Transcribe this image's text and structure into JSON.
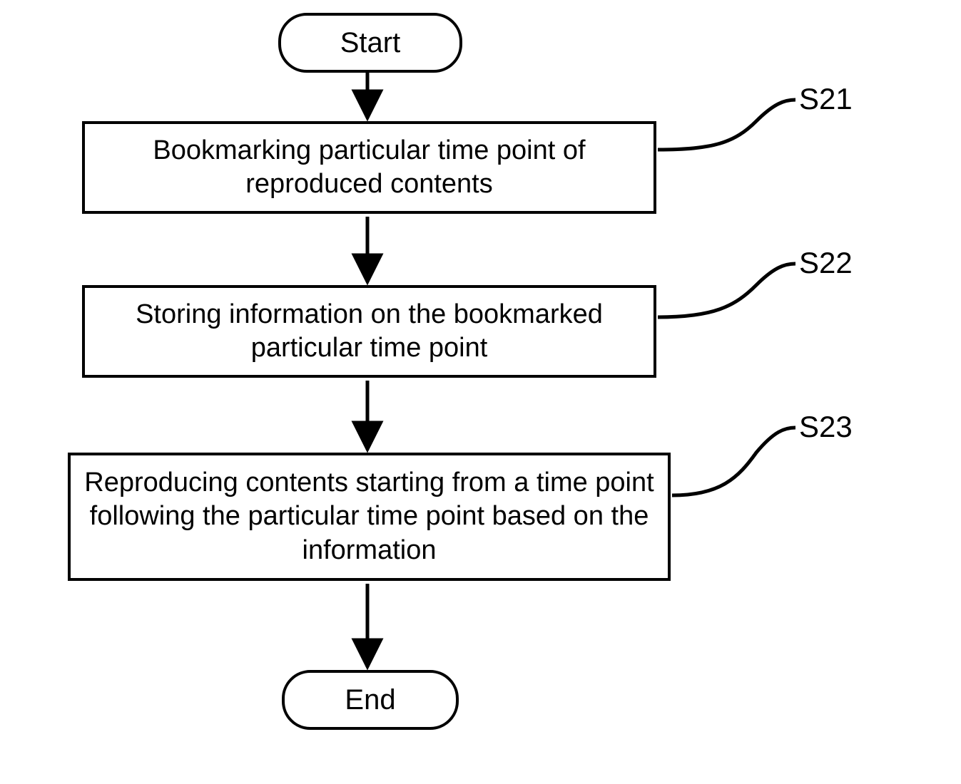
{
  "chart_data": {
    "type": "flowchart",
    "nodes": [
      {
        "id": "start",
        "kind": "terminator",
        "text": "Start"
      },
      {
        "id": "s21",
        "kind": "process",
        "label": "S21",
        "text": "Bookmarking particular time point of\nreproduced contents"
      },
      {
        "id": "s22",
        "kind": "process",
        "label": "S22",
        "text": "Storing information on\nthe bookmarked particular time point"
      },
      {
        "id": "s23",
        "kind": "process",
        "label": "S23",
        "text": "Reproducing contents starting from a time\npoint following the particular time point\nbased on the information"
      },
      {
        "id": "end",
        "kind": "terminator",
        "text": "End"
      }
    ],
    "edges": [
      {
        "from": "start",
        "to": "s21"
      },
      {
        "from": "s21",
        "to": "s22"
      },
      {
        "from": "s22",
        "to": "s23"
      },
      {
        "from": "s23",
        "to": "end"
      }
    ]
  },
  "start_label": "Start",
  "end_label": "End",
  "step1_text": "Bookmarking particular time point of reproduced contents",
  "step2_text": "Storing information on the bookmarked particular time point",
  "step3_text": "Reproducing contents starting from a time point following the particular time point based on the information",
  "label_s21": "S21",
  "label_s22": "S22",
  "label_s23": "S23"
}
